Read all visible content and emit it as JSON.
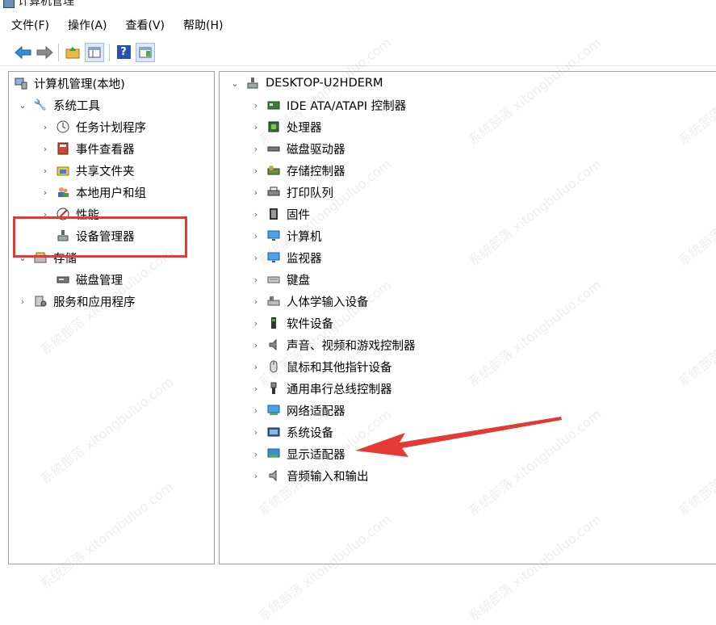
{
  "window": {
    "title": "计算机管理"
  },
  "menubar": [
    {
      "name": "menu-file",
      "label": "文件(F)"
    },
    {
      "name": "menu-action",
      "label": "操作(A)"
    },
    {
      "name": "menu-view",
      "label": "查看(V)"
    },
    {
      "name": "menu-help",
      "label": "帮助(H)"
    }
  ],
  "left_tree": [
    {
      "name": "tree-root",
      "label": "计算机管理(本地)",
      "chev": "",
      "icon": "computer-mgmt-icon",
      "level": 0
    },
    {
      "name": "tree-system-tools",
      "label": "系统工具",
      "chev": "down",
      "icon": "tools-icon",
      "level": 1
    },
    {
      "name": "tree-task-scheduler",
      "label": "任务计划程序",
      "chev": "right",
      "icon": "clock-icon",
      "level": 2
    },
    {
      "name": "tree-event-viewer",
      "label": "事件查看器",
      "chev": "right",
      "icon": "event-viewer-icon",
      "level": 2
    },
    {
      "name": "tree-shared-folders",
      "label": "共享文件夹",
      "chev": "right",
      "icon": "shared-folder-icon",
      "level": 2
    },
    {
      "name": "tree-local-users",
      "label": "本地用户和组",
      "chev": "right",
      "icon": "users-icon",
      "level": 2
    },
    {
      "name": "tree-performance",
      "label": "性能",
      "chev": "right",
      "icon": "performance-icon",
      "level": 2
    },
    {
      "name": "tree-device-manager",
      "label": "设备管理器",
      "chev": "",
      "icon": "device-manager-icon",
      "level": 2
    },
    {
      "name": "tree-storage",
      "label": "存储",
      "chev": "down",
      "icon": "storage-icon",
      "level": 1
    },
    {
      "name": "tree-disk-management",
      "label": "磁盘管理",
      "chev": "",
      "icon": "disk-icon",
      "level": 2
    },
    {
      "name": "tree-services-apps",
      "label": "服务和应用程序",
      "chev": "right",
      "icon": "services-icon",
      "level": 1
    }
  ],
  "right_tree": {
    "root": {
      "label": "DESKTOP-U2HDERM",
      "icon": "computer-icon"
    },
    "items": [
      {
        "name": "dev-ide",
        "label": "IDE ATA/ATAPI 控制器",
        "icon": "ide-controller-icon"
      },
      {
        "name": "dev-processor",
        "label": "处理器",
        "icon": "processor-icon"
      },
      {
        "name": "dev-disk-drives",
        "label": "磁盘驱动器",
        "icon": "disk-drive-icon"
      },
      {
        "name": "dev-storage-ctrl",
        "label": "存储控制器",
        "icon": "storage-controller-icon"
      },
      {
        "name": "dev-print-queue",
        "label": "打印队列",
        "icon": "printer-icon"
      },
      {
        "name": "dev-firmware",
        "label": "固件",
        "icon": "firmware-icon"
      },
      {
        "name": "dev-computer",
        "label": "计算机",
        "icon": "monitor-icon"
      },
      {
        "name": "dev-monitors",
        "label": "监视器",
        "icon": "monitor-icon"
      },
      {
        "name": "dev-keyboard",
        "label": "键盘",
        "icon": "keyboard-icon"
      },
      {
        "name": "dev-hid",
        "label": "人体学输入设备",
        "icon": "hid-icon"
      },
      {
        "name": "dev-software",
        "label": "软件设备",
        "icon": "software-device-icon"
      },
      {
        "name": "dev-audio",
        "label": "声音、视频和游戏控制器",
        "icon": "speaker-icon"
      },
      {
        "name": "dev-mouse",
        "label": "鼠标和其他指针设备",
        "icon": "mouse-icon"
      },
      {
        "name": "dev-usb",
        "label": "通用串行总线控制器",
        "icon": "usb-icon"
      },
      {
        "name": "dev-network",
        "label": "网络适配器",
        "icon": "network-adapter-icon"
      },
      {
        "name": "dev-system",
        "label": "系统设备",
        "icon": "system-device-icon"
      },
      {
        "name": "dev-display",
        "label": "显示适配器",
        "icon": "display-adapter-icon"
      },
      {
        "name": "dev-audio-io",
        "label": "音频输入和输出",
        "icon": "audio-io-icon"
      }
    ]
  },
  "watermark": "系统部落 xitongbuluo.com",
  "colors": {
    "highlight": "#e53935",
    "accent": "#1e6fc8"
  }
}
